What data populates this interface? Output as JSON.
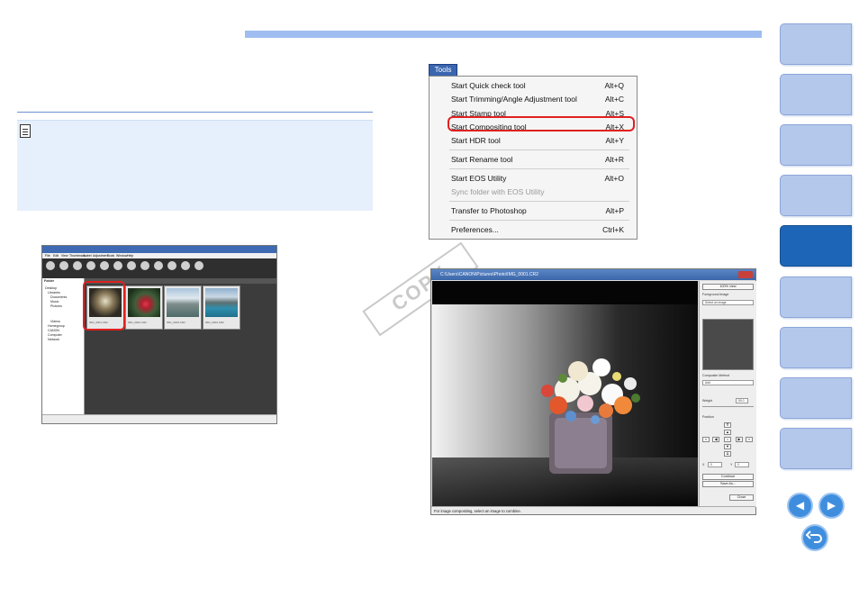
{
  "tools_menu": {
    "tab_label": "Tools",
    "items": [
      {
        "label": "Start Quick check tool",
        "shortcut": "Alt+Q"
      },
      {
        "label": "Start Trimming/Angle Adjustment tool",
        "shortcut": "Alt+C"
      },
      {
        "label": "Start Stamp tool",
        "shortcut": "Alt+S"
      },
      {
        "label": "Start Compositing tool",
        "shortcut": "Alt+X"
      },
      {
        "label": "Start HDR tool",
        "shortcut": "Alt+Y"
      },
      {
        "label": "Start Rename tool",
        "shortcut": "Alt+R"
      },
      {
        "label": "Start EOS Utility",
        "shortcut": "Alt+O"
      },
      {
        "label": "Sync folder with EOS Utility",
        "shortcut": ""
      },
      {
        "label": "Transfer to Photoshop",
        "shortcut": "Alt+P"
      },
      {
        "label": "Preferences...",
        "shortcut": "Ctrl+K"
      }
    ]
  },
  "dpp_window": {
    "menu": [
      "File",
      "Edit",
      "View",
      "Thumbnails",
      "Label",
      "Adjustment",
      "Tools",
      "Window",
      "Help"
    ],
    "folder_tabs": [
      "Folder"
    ],
    "tree": [
      "Desktop",
      "Libraries",
      "Documents",
      "Music",
      "Pictures",
      "Videos",
      "Homegroup",
      "CANON",
      "Computer",
      "Network"
    ],
    "thumbnails": [
      "IMG_0001.CR2",
      "IMG_0002.CR2",
      "IMG_0003.CR2",
      "IMG_0004.CR2"
    ]
  },
  "compositing_window": {
    "title": "C:\\Users\\CANON\\Pictures\\Photo\\IMG_0001.CR2",
    "panel": {
      "view_button": "100% view",
      "foreground_label": "Foreground image",
      "foreground_select": "Select an image",
      "composite_label": "Composite Method",
      "composite_select": "Add",
      "weight_label": "Weight",
      "weight_value": "50.0",
      "position_label": "Position",
      "x_label": "X",
      "x_value": "0",
      "y_label": "Y",
      "y_value": "0",
      "continue_button": "Continue",
      "save_button": "Save As...",
      "close_button": "Close"
    },
    "status": "For image compositing, select an image to combine."
  },
  "watermark": "COPY",
  "colors": {
    "accent_blue": "#9fbdf0",
    "nav_tab": "#b4c8ec",
    "nav_tab_active": "#1d66b7",
    "highlight_red": "#e02020"
  }
}
